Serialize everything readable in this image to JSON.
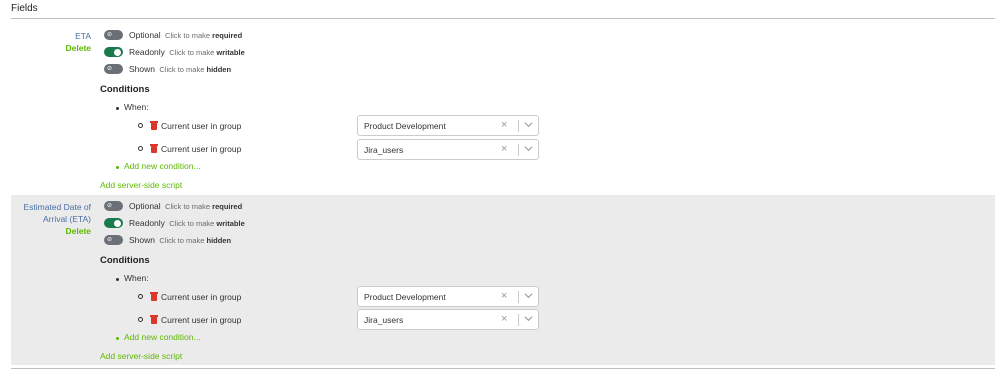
{
  "section": {
    "title": "Fields"
  },
  "fields": [
    {
      "name": "ETA",
      "delete_label": "Delete",
      "options": {
        "optional": {
          "state": "Optional",
          "hint": "Click to make",
          "target": "required"
        },
        "readonly": {
          "state": "Readonly",
          "hint": "Click to make",
          "target": "writable"
        },
        "shown": {
          "state": "Shown",
          "hint": "Click to make",
          "target": "hidden"
        }
      },
      "conditions_title": "Conditions",
      "when_label": "When:",
      "conditions": [
        {
          "label": "Current user in group",
          "value": "Product Development"
        },
        {
          "label": "Current user in group",
          "value": "Jira_users"
        }
      ],
      "add_condition": "Add new condition...",
      "add_script": "Add server-side script"
    },
    {
      "name": "Estimated Date of Arrival (ETA)",
      "name_line1": "Estimated Date of",
      "name_line2": "Arrival (ETA)",
      "delete_label": "Delete",
      "options": {
        "optional": {
          "state": "Optional",
          "hint": "Click to make",
          "target": "required"
        },
        "readonly": {
          "state": "Readonly",
          "hint": "Click to make",
          "target": "writable"
        },
        "shown": {
          "state": "Shown",
          "hint": "Click to make",
          "target": "hidden"
        }
      },
      "conditions_title": "Conditions",
      "when_label": "When:",
      "conditions": [
        {
          "label": "Current user in group",
          "value": "Product Development"
        },
        {
          "label": "Current user in group",
          "value": "Jira_users"
        }
      ],
      "add_condition": "Add new condition...",
      "add_script": "Add server-side script"
    }
  ],
  "toggle_states": {
    "optional": "off",
    "readonly": "on",
    "shown": "off"
  },
  "colors": {
    "link_green": "#5cb800",
    "toggle_on": "#1a7a4e",
    "toggle_off": "#6b6f77",
    "trash_red": "#d9382a",
    "shaded_bg": "#ebebeb"
  },
  "icons": {
    "trash": "trash-icon",
    "clear": "clear-icon",
    "chevron": "chevron-down-icon"
  }
}
